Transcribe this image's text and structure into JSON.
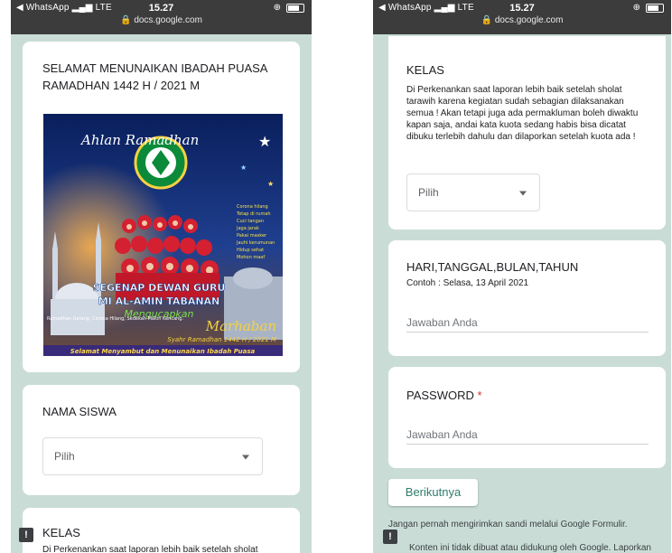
{
  "status_bar": {
    "carrier": "◀ WhatsApp",
    "signal": "LTE",
    "time": "15.27",
    "url": "docs.google.com"
  },
  "phone1": {
    "header_title": "SELAMAT MENUNAIKAN IBADAH PUASA RAMADHAN 1442 H / 2021 M",
    "poster": {
      "top_logo_text": "Ahlan Ramadhan",
      "headline_1": "SEGENAP DEWAN GURU",
      "headline_2": "MI AL-AMIN TABANAN",
      "headline_3": "Mengucapkan",
      "marhaban": "Marhaban",
      "year_line": "Syahr Ramadhan 1442 H / 2021 M",
      "bottom_banner": "Selamat Menyambut dan Menunaikan Ibadah Puasa",
      "left_caption": "Ramadhan Datang, Corona Hilang, Sedekah Makin Kencang."
    },
    "nama_siswa": {
      "label": "NAMA SISWA",
      "selected": "Pilih"
    },
    "kelas_peek": {
      "label": "KELAS",
      "desc_start": "Di Perkenankan saat laporan lebih baik setelah sholat"
    }
  },
  "phone2": {
    "kelas": {
      "label": "KELAS",
      "desc": "Di Perkenankan saat laporan lebih baik setelah sholat tarawih karena kegiatan sudah sebagian dilaksanakan semua ! Akan tetapi juga ada permakluman boleh diwaktu kapan saja, andai kata kuota sedang habis bisa dicatat dibuku terlebih dahulu dan dilaporkan setelah kuota ada !",
      "selected": "Pilih"
    },
    "tanggal": {
      "label": "HARI,TANGGAL,BULAN,TAHUN",
      "hint": "Contoh : Selasa, 13 April 2021",
      "placeholder": "Jawaban Anda"
    },
    "password": {
      "label": "PASSWORD",
      "required_mark": "*",
      "placeholder": "Jawaban Anda"
    },
    "next_button": "Berikutnya",
    "footer_warning": "Jangan pernah mengirimkan sandi melalui Google Formulir.",
    "footer_disclaimer": "Konten ini tidak dibuat atau didukung oleh Google. Laporkan"
  },
  "colors": {
    "page_bg": "#c9ddd6",
    "accent_green": "#2e7d6b",
    "required_red": "#d93025"
  }
}
